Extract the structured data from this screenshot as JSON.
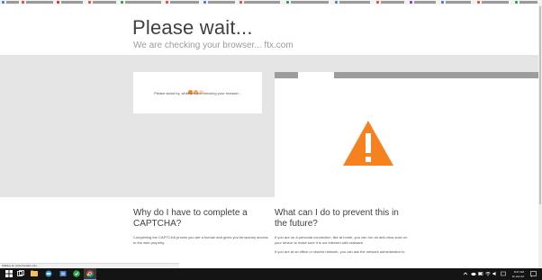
{
  "page": {
    "title": "Please wait...",
    "subtitle": "We are checking your browser... ftx.com",
    "card_text": "Please stand by, while we are checking your browser..."
  },
  "faq": [
    {
      "heading": "Why do I have to complete a CAPTCHA?",
      "body": "Completing the CAPTCHA proves you are a human and gives you temporary access to the web property."
    },
    {
      "heading": "What can I do to prevent this in the future?",
      "body": "If you are on a personal connection, like at home, you can run an anti-virus scan on your device to make sure it is not infected with malware.",
      "body2": "If you are at an office or shared network, you can ask the network administrator to run a scan across the network looking for"
    }
  ],
  "status_bar": {
    "text": "Waiting for www.ftxstatic.com..."
  },
  "taskbar": {
    "time": "8:27 AM",
    "date": "11-Jan-22",
    "icons": [
      "windows-icon",
      "search-icon",
      "file-explorer-icon",
      "edge-icon",
      "store-icon",
      "excel-icon",
      "green-app-icon",
      "chrome-icon"
    ]
  },
  "colors": {
    "accent_orange": "#f5821f",
    "gray_band": "#e5e5e5",
    "browser_bar": "#9d9d9d"
  }
}
